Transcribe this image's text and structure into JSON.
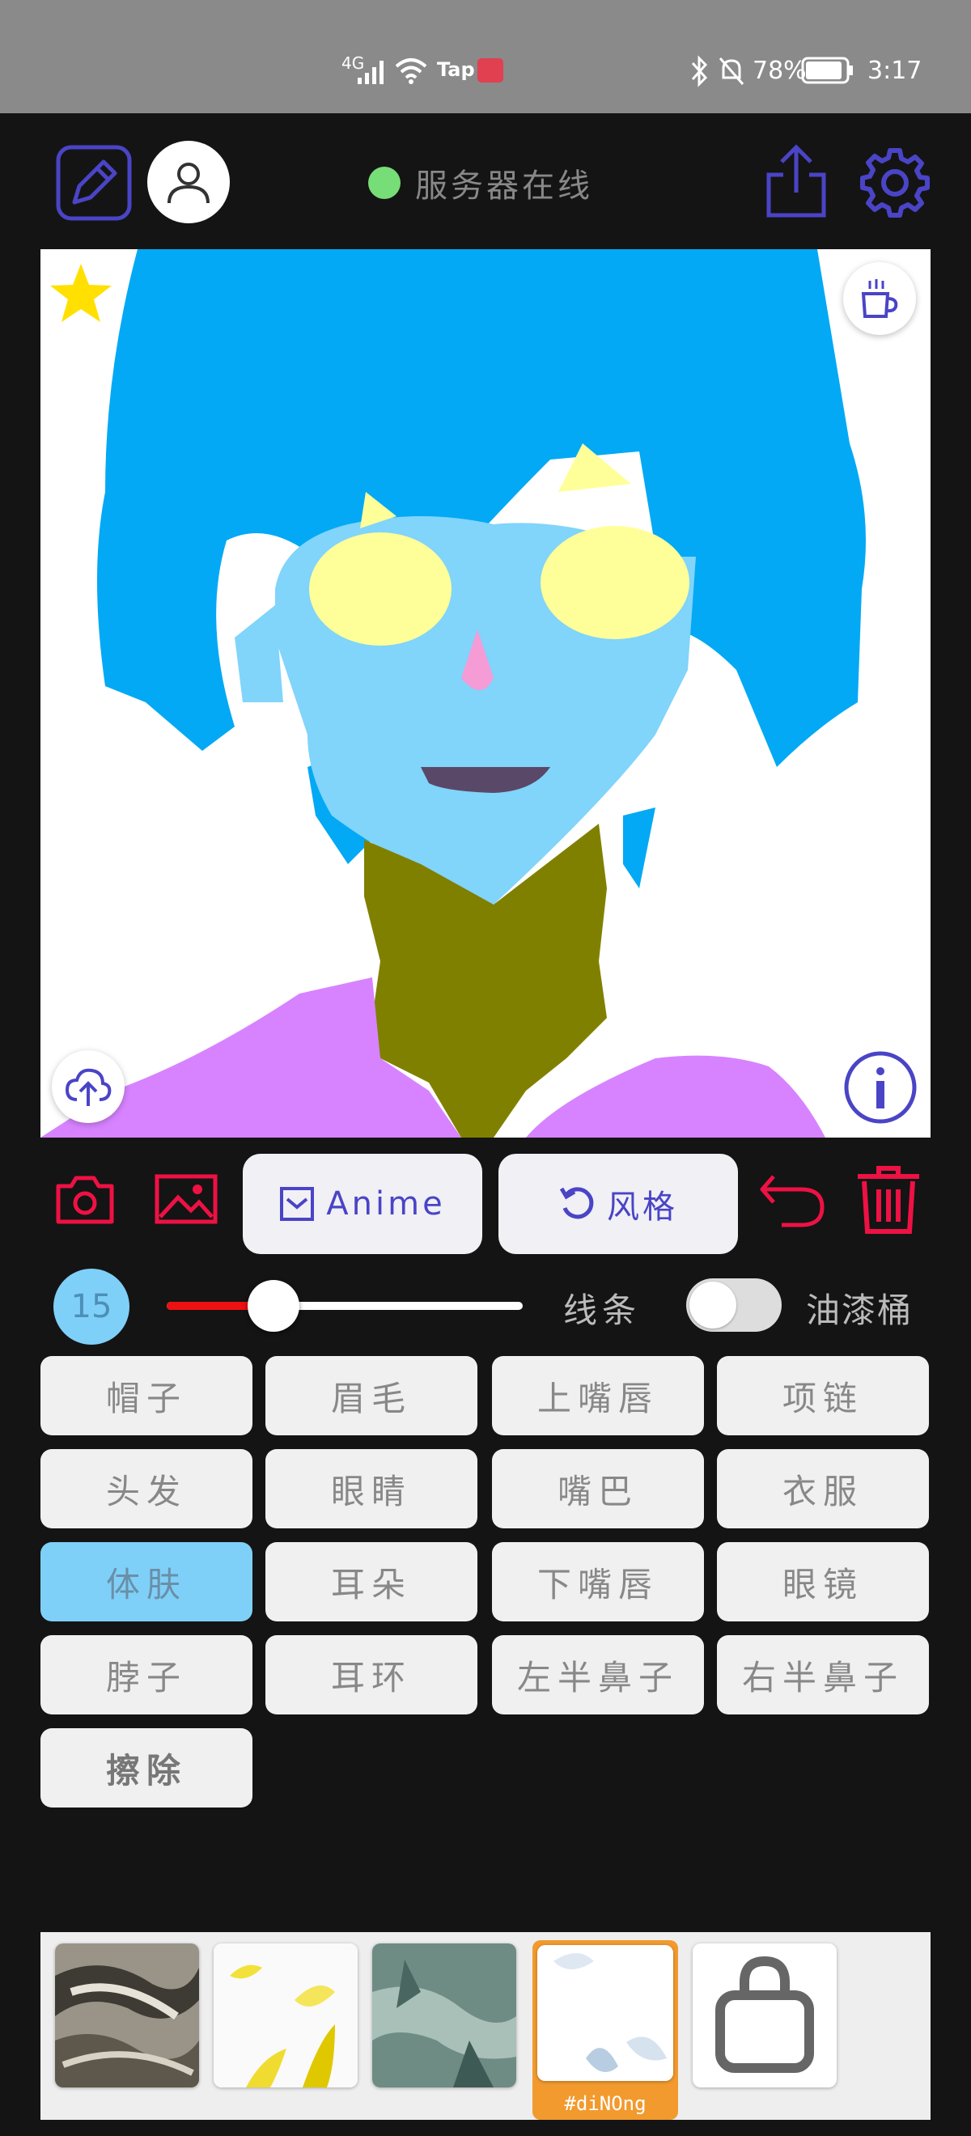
{
  "status_bar": {
    "network": "4G",
    "carrier_app": "Tap",
    "battery": "78%",
    "time": "3:17"
  },
  "header": {
    "server_status": "服务器在线",
    "server_color": "#77dd77",
    "icons": [
      "edit-icon",
      "user-icon",
      "share-icon",
      "gear-icon"
    ]
  },
  "canvas": {
    "icons": [
      "star-icon",
      "coffee-icon",
      "cloud-upload-icon",
      "info-icon"
    ]
  },
  "toolbar": {
    "anime_label": "Anime",
    "style_label": "风格",
    "icons": [
      "camera-icon",
      "image-icon",
      "undo-icon",
      "trash-icon"
    ]
  },
  "brush": {
    "size": "15",
    "level_fraction": 0.3,
    "line_label": "线条",
    "bucket_label": "油漆桶",
    "bucket_enabled": false
  },
  "parts": [
    {
      "label": "帽子",
      "selected": false
    },
    {
      "label": "眉毛",
      "selected": false
    },
    {
      "label": "上嘴唇",
      "selected": false
    },
    {
      "label": "项链",
      "selected": false
    },
    {
      "label": "头发",
      "selected": false
    },
    {
      "label": "眼睛",
      "selected": false
    },
    {
      "label": "嘴巴",
      "selected": false
    },
    {
      "label": "衣服",
      "selected": false
    },
    {
      "label": "体肤",
      "selected": true
    },
    {
      "label": "耳朵",
      "selected": false
    },
    {
      "label": "下嘴唇",
      "selected": false
    },
    {
      "label": "眼镜",
      "selected": false
    },
    {
      "label": "脖子",
      "selected": false
    },
    {
      "label": "耳环",
      "selected": false
    },
    {
      "label": "左半鼻子",
      "selected": false
    },
    {
      "label": "右半鼻子",
      "selected": false
    },
    {
      "label": "擦除",
      "selected": false
    }
  ],
  "styles": {
    "selected_label": "#diNOng",
    "icons": [
      "shopping-bag-icon"
    ]
  },
  "colors": {
    "accent": "#4a44c6",
    "danger": "#ee1144",
    "hair": "#03a9f4",
    "skin": "#81d4fa",
    "neck": "#808000",
    "clothes": "#d783ff",
    "eyes": "#ffff99"
  }
}
